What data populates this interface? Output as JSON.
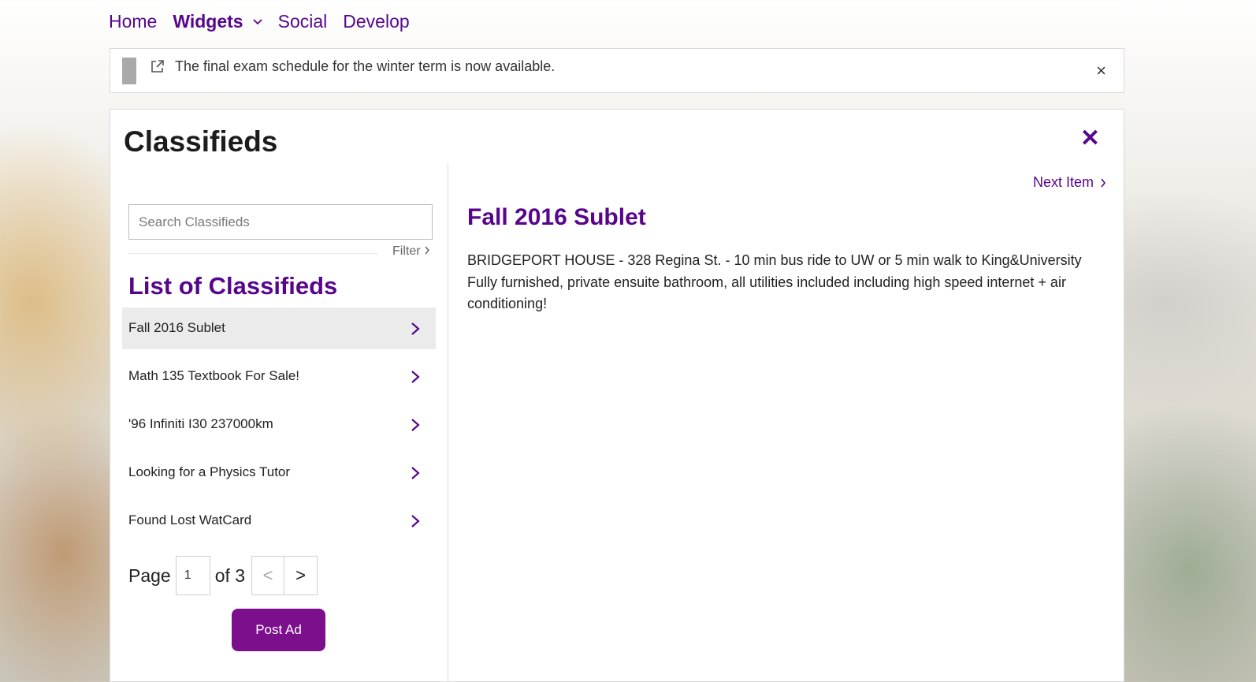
{
  "nav": {
    "items": [
      {
        "label": "Home"
      },
      {
        "label": "Widgets"
      },
      {
        "label": "Social"
      },
      {
        "label": "Develop"
      }
    ]
  },
  "announcement": {
    "message": "The final exam schedule for the winter term is now available.",
    "close_label": "×"
  },
  "panel": {
    "title": "Classifieds",
    "close_label": "✕"
  },
  "search": {
    "placeholder": "Search Classifieds",
    "value": ""
  },
  "filter": {
    "label": "Filter"
  },
  "list": {
    "heading": "List of Classifieds",
    "items": [
      {
        "label": "Fall 2016 Sublet"
      },
      {
        "label": "Math 135 Textbook For Sale!"
      },
      {
        "label": "'96 Infiniti I30 237000km"
      },
      {
        "label": "Looking for a Physics Tutor"
      },
      {
        "label": "Found Lost WatCard"
      }
    ]
  },
  "pager": {
    "page_label": "Page",
    "current_page": "1",
    "of_label": "of 3",
    "prev_label": "<",
    "next_label": ">"
  },
  "post_ad": {
    "label": "Post Ad"
  },
  "detail": {
    "next_item_label": "Next Item",
    "title": "Fall 2016 Sublet",
    "body": "BRIDGEPORT HOUSE - 328 Regina St. - 10 min bus ride to UW or 5 min walk to King&University Fully furnished, private ensuite bathroom, all utilities included including high speed internet + air conditioning!"
  },
  "colors": {
    "accent": "#57068c",
    "button": "#7b0f8c"
  }
}
